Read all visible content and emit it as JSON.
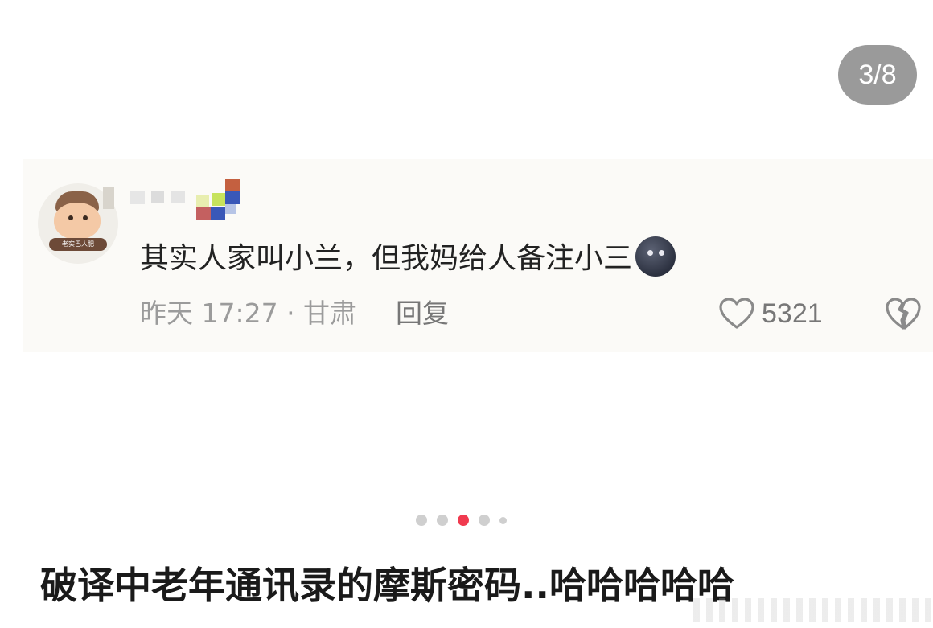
{
  "pager": {
    "counter": "3/8"
  },
  "comment": {
    "avatar_badge": "老实巴人肥",
    "text": "其实人家叫小兰，但我妈给人备注小三",
    "emoji": "moon-face-emoji",
    "time_location": "昨天 17:27 · 甘肃",
    "reply_label": "回复",
    "like_count": "5321",
    "like_icon": "heart-outline-icon",
    "dislike_icon": "broken-heart-icon"
  },
  "carousel": {
    "dot_count": 5,
    "active_index": 2
  },
  "caption": "破译中老年通讯录的摩斯密码..哈哈哈哈哈",
  "colors": {
    "accent_dot": "#f03a4f",
    "counter_bg": "#9a9a9a",
    "meta_text": "#9b9b9b"
  }
}
